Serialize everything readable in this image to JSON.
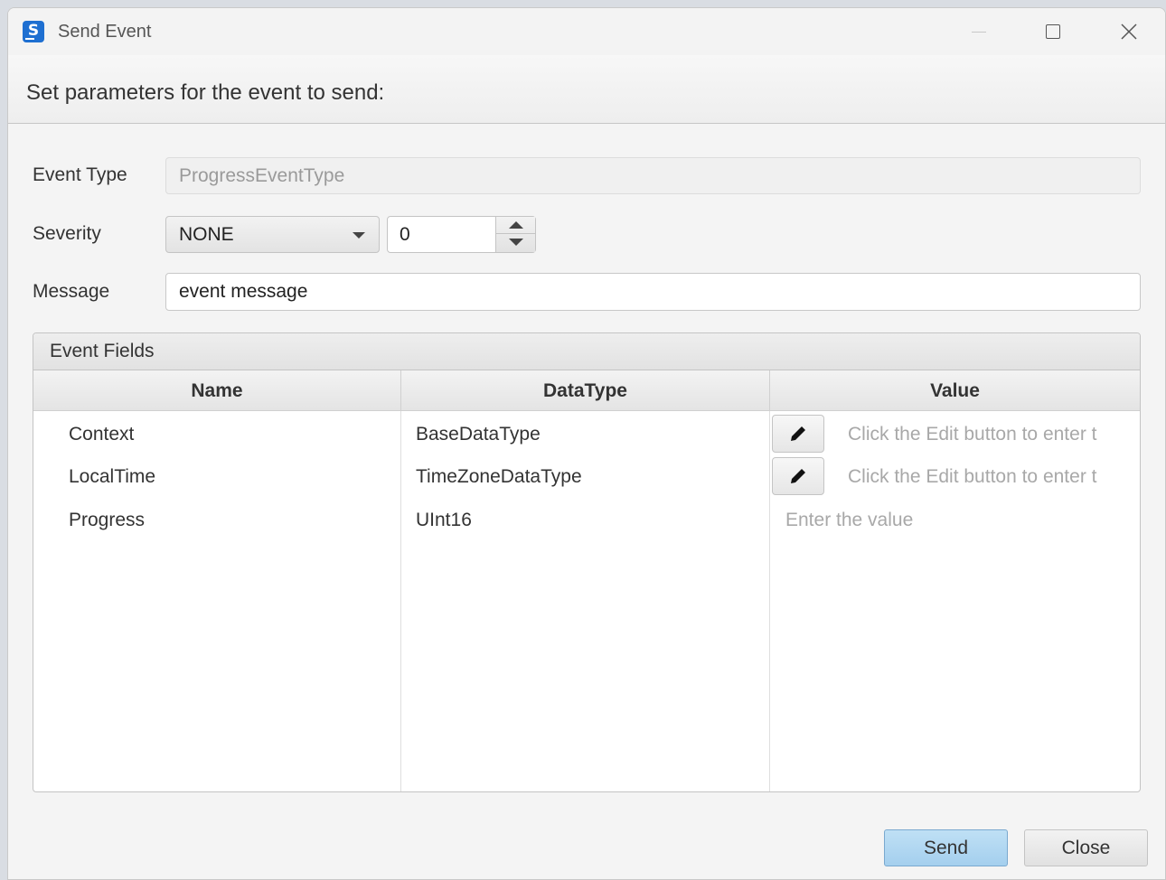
{
  "window": {
    "title": "Send Event",
    "icon": "app-s-icon",
    "controls": [
      "minimize-icon",
      "maximize-icon",
      "close-icon"
    ]
  },
  "header": {
    "text": "Set parameters for the event to send:"
  },
  "form": {
    "event_type_label": "Event Type",
    "event_type_value": "ProgressEventType",
    "severity_label": "Severity",
    "severity_selected": "NONE",
    "severity_number": "0",
    "message_label": "Message",
    "message_value": "event message"
  },
  "event_fields": {
    "title": "Event Fields",
    "columns": [
      "Name",
      "DataType",
      "Value"
    ],
    "rows": [
      {
        "name": "Context",
        "datatype": "BaseDataType",
        "value": "Click the Edit button to enter t",
        "has_edit": true
      },
      {
        "name": "LocalTime",
        "datatype": "TimeZoneDataType",
        "value": "Click the Edit button to enter t",
        "has_edit": true
      },
      {
        "name": "Progress",
        "datatype": "UInt16",
        "value": "Enter the value",
        "has_edit": false
      }
    ]
  },
  "buttons": {
    "send": "Send",
    "close": "Close"
  },
  "colors": {
    "accent_button": "#a4cfee",
    "app_icon": "#1e6fd1"
  }
}
